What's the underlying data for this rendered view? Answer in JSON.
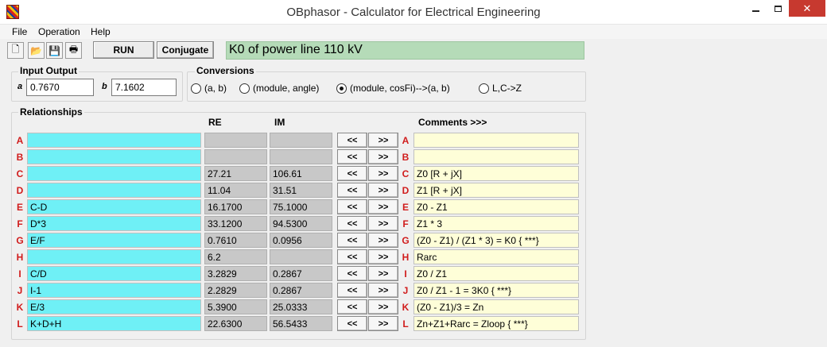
{
  "window": {
    "title": "OBphasor - Calculator for Electrical Engineering",
    "minimize": "—",
    "close": "✕"
  },
  "menu": [
    "File",
    "Operation",
    "Help"
  ],
  "toolbar": {
    "icons": [
      "new-file-icon",
      "open-folder-icon",
      "save-icon",
      "print-icon"
    ],
    "icon_glyphs": [
      "🗋",
      "📂",
      "💾",
      "🖶"
    ],
    "run_label": "RUN",
    "conjugate_label": "Conjugate",
    "title_value": "K0 of power line 110 kV"
  },
  "input_output": {
    "label": "Input Output",
    "a_glyph": "a",
    "b_glyph": "b",
    "a_value": "0.7670",
    "b_value": "7.1602"
  },
  "conversions": {
    "label": "Conversions",
    "options": [
      "(a, b)",
      "(module, angle)",
      "(module, cosFi)-->(a, b)",
      "L,C->Z"
    ],
    "selected_index": 2
  },
  "relationships": {
    "label": "Relationships",
    "col_re": "RE",
    "col_im": "IM",
    "col_comments": "Comments >>>",
    "left_arrow": "<<",
    "right_arrow": ">>",
    "rows": [
      {
        "id": "A",
        "expr": "",
        "re": "",
        "im": "",
        "comment": ""
      },
      {
        "id": "B",
        "expr": "",
        "re": "",
        "im": "",
        "comment": ""
      },
      {
        "id": "C",
        "expr": "",
        "re": "27.21",
        "im": "106.61",
        "comment": "Z0 [R + jX]"
      },
      {
        "id": "D",
        "expr": "",
        "re": "11.04",
        "im": "31.51",
        "comment": "Z1 [R + jX]"
      },
      {
        "id": "E",
        "expr": "C-D",
        "re": "16.1700",
        "im": "75.1000",
        "comment": "Z0 - Z1"
      },
      {
        "id": "F",
        "expr": "D*3",
        "re": "33.1200",
        "im": "94.5300",
        "comment": "Z1 * 3"
      },
      {
        "id": "G",
        "expr": "E/F",
        "re": "0.7610",
        "im": "0.0956",
        "comment": "(Z0 - Z1) / (Z1 * 3) = K0    { ***}"
      },
      {
        "id": "H",
        "expr": "",
        "re": "6.2",
        "im": "",
        "comment": "Rarc"
      },
      {
        "id": "I",
        "expr": "C/D",
        "re": "3.2829",
        "im": "0.2867",
        "comment": "Z0 / Z1"
      },
      {
        "id": "J",
        "expr": "I-1",
        "re": "2.2829",
        "im": "0.2867",
        "comment": "Z0 / Z1 - 1 = 3K0            { ***}"
      },
      {
        "id": "K",
        "expr": "E/3",
        "re": "5.3900",
        "im": "25.0333",
        "comment": "(Z0 - Z1)/3 = Zn"
      },
      {
        "id": "L",
        "expr": "K+D+H",
        "re": "22.6300",
        "im": "56.5433",
        "comment": "Zn+Z1+Rarc = Zloop   { ***}"
      }
    ]
  }
}
